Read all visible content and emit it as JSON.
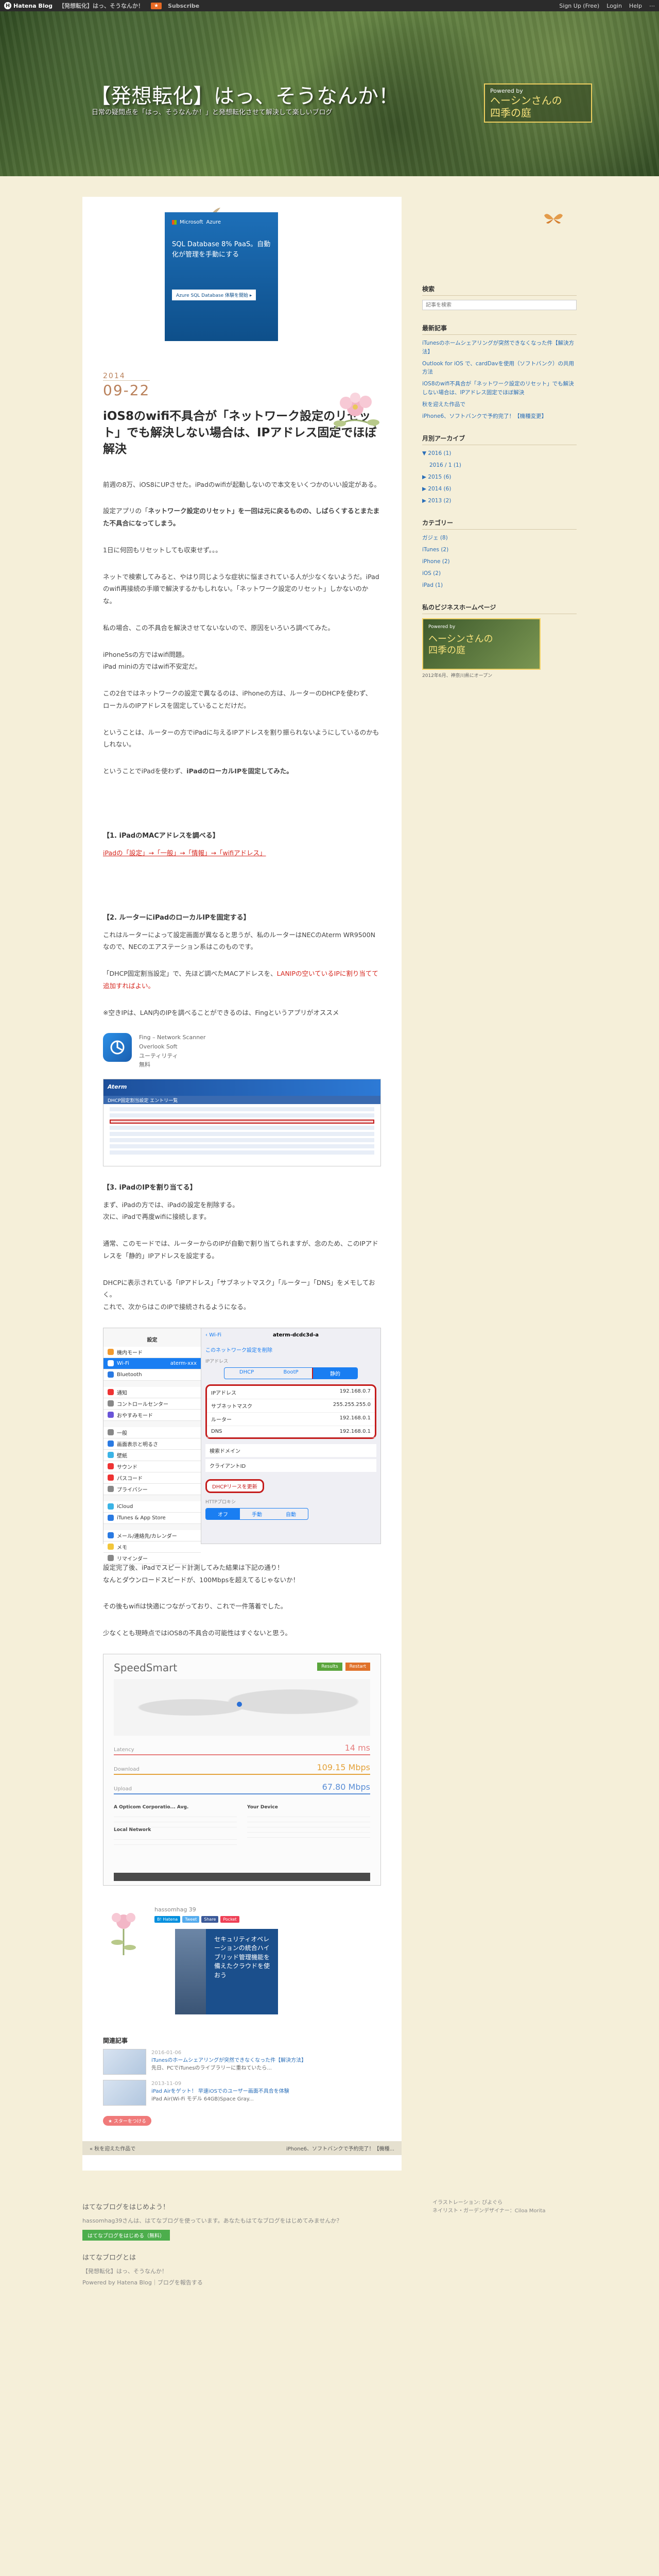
{
  "topbar": {
    "brand": "Hatena Blog",
    "blog_name": "【発想転化】はっ、そうなんか！",
    "star": "★",
    "subscribe": "Subscribe",
    "signup": "Sign Up (Free)",
    "login": "Login",
    "help": "Help",
    "more": "⋯"
  },
  "header": {
    "title": "【発想転化】はっ、そうなんか！",
    "description": "日常の疑問点を「はっ、そうなんか！」と発想転化させて解決して楽しいブログ",
    "badge_by": "Powered by",
    "badge_title": "ヘーシンさんの\n四季の庭"
  },
  "ad_top": {
    "brand": "Microsoft",
    "partner": "Azure",
    "headline": "SQL Database 8% PaaS。自動化が管理を手動にする",
    "button": "Azure SQL Database 体験を開始 ▸"
  },
  "entry": {
    "year": "2014",
    "date": "09-22",
    "title": "iOS8のwifi不具合が「ネットワーク設定のリセット」でも解決しない場合は、IPアドレス固定でほぼ解決",
    "p1": "前週の8万、iOS8にUPさせた。iPadのwifiが起動しないので本文をいくつかのいい設定がある。",
    "p2a": "設定アプリの「",
    "p2b": "ネットワーク設定のリセット",
    "p2c": "」を一回は元に戻るものの、しばらくするとまたまた不具合になってしまう。",
    "p3": "1日に何回もリセットしても収束せず。。。",
    "p4": "ネットで検索してみると、やはり同じような症状に悩まされている人が少なくないようだ。iPadのwifi再接続の手順で解決するかもしれない。「ネットワーク設定のリセット」しかないのかな。",
    "p5": "私の場合、この不具合を解決させてないないので、原因をいろいろ調べてみた。",
    "p6a": "iPhone5sの方ではwifi問題。",
    "p6b": "iPad miniの方ではwifi不安定だ。",
    "p7a": "この2台ではネットワークの設定で異なるのは、iPhoneの方は、ルーターのDHCPを使わず、",
    "p7b": "ローカルのIPアドレスを固定していることだけだ。",
    "p8": "ということは、ルーターの方でiPadに与えるIPアドレスを割り振られないようにしているのかもしれない。",
    "p9a": "ということでiPadを使わず、",
    "p9b": "iPadのローカルIPを固定してみた。",
    "h1": "【1. iPadのMACアドレスを調べる】",
    "h1_path": "iPadの「設定」→「一般」→「情報」→「wifiアドレス」",
    "h2": "【2. ルーターにiPadのローカルIPを固定する】",
    "p10": "これはルーターによって設定画面が異なると思うが、私のルーターはNECのAterm WR9500Nなので、NECのエアステーション系はこのものです。",
    "p11a": "「DHCP固定割当設定」で、先ほど調べたMACアドレスを、",
    "p11b": "LANIPの空いているIPに割り当てて追加すればよい。",
    "p12": "※空きIPは、LAN内のIPを調べることができるのは、Fingというアプリがオススメ",
    "h3": "【3. iPadのIPを割り当てる】",
    "p13a": "まず、iPadの方では、iPadの設定を削除する。",
    "p13b": "次に、iPadで再度wifiに接続します。",
    "p14": "通常、このモードでは、ルーターからのIPが自動で割り当てられますが、念のため、このIPアドレスを「静的」IPアドレスを設定する。",
    "p15a": "DHCPに表示されている「IPアドレス」「サブネットマスク」「ルーター」「DNS」をメモしておく。",
    "p15b": "これで、次からはこのIPで接続されるようになる。",
    "p16a": "設定完了後、iPadでスピード計測してみた結果は下記の通り！",
    "p16b": "なんとダウンロードスピードが、100Mbpsを超えてるじゃないか！",
    "p17": "その後もwifiは快適につながっており、これで一件落着でした。",
    "p18": "少なくとも現時点ではiOS8の不具合の可能性はすぐないと思う。"
  },
  "app": {
    "name": "Fing – Network Scanner",
    "maker": "Overlook Soft",
    "category": "ユーティリティ",
    "price": "無料"
  },
  "router_ss": {
    "brand": "Aterm",
    "title": "DHCP固定割当設定 エントリ一覧"
  },
  "ipad_ss": {
    "left_header": "設定",
    "items": [
      "機内モード",
      "Wi-Fi",
      "Bluetooth",
      "通知",
      "コントロールセンター",
      "おやすみモード",
      "一般",
      "画面表示と明るさ",
      "壁紙",
      "サウンド",
      "パスコード",
      "プライバシー",
      "iCloud",
      "iTunes & App Store",
      "メール/連絡先/カレンダー",
      "メモ",
      "リマインダー"
    ],
    "wifi_value": "aterm-xxx",
    "nav_back": "Wi-Fi",
    "nav_title": "aterm-dcdc3d-a",
    "forget": "このネットワーク設定を削除",
    "ip_label": "IPアドレス",
    "segments": [
      "DHCP",
      "BootP",
      "静的"
    ],
    "ip_rows": [
      {
        "k": "IPアドレス",
        "v": "192.168.0.7"
      },
      {
        "k": "サブネットマスク",
        "v": "255.255.255.0"
      },
      {
        "k": "ルーター",
        "v": "192.168.0.1"
      },
      {
        "k": "DNS",
        "v": "192.168.0.1"
      }
    ],
    "search_domain": "検索ドメイン",
    "client_id": "クライアントID",
    "dhcp_button": "DHCPリースを更新",
    "http_proxy": "HTTPプロキシ",
    "proxy_segments": [
      "オフ",
      "手動",
      "自動"
    ]
  },
  "speed_ss": {
    "brand": "SpeedSmart",
    "btn_a": "Results",
    "btn_b": "Restart",
    "latency_label": "Latency",
    "latency_val": "14 ms",
    "download_label": "Download",
    "download_val": "109.15 Mbps",
    "upload_label": "Upload",
    "upload_val": "67.80 Mbps",
    "col1": "A Opticom Corporatio... Avg.",
    "col2": "Your Device",
    "col3": "Local Network"
  },
  "author": {
    "name": "hassomhag 39",
    "share_a": "B! Hatena",
    "share_b": "Tweet",
    "share_c": "Share",
    "share_d": "Pocket"
  },
  "ad_side": {
    "text": "セキュリティオペレーションの統合ハイブリッド管理機能を備えたクラウドを使おう"
  },
  "related": {
    "heading": "関連記事",
    "items": [
      {
        "date": "2016-01-06",
        "title": "iTunesのホームシェアリングが突然できなくなった件【解決方法】",
        "desc": "先日、PCでiTunesのライブラリーに重ねていたら..."
      },
      {
        "date": "2013-11-09",
        "title": "iPad Airをゲット！ 早速iOSでのユーザー画面不具合を体験",
        "desc": "iPad Air(Wi-Fi モデル 64GB)Space Gray..."
      }
    ]
  },
  "star_btn": "★ スターをつける",
  "pager": {
    "prev": "« 秋を迎えた作品で",
    "next": "iPhone6、ソフトバンクで予約完了！【機種..."
  },
  "sidebar": {
    "search_h": "検索",
    "search_ph": "記事を検索",
    "recent_h": "最新記事",
    "recent": [
      "iTunesのホームシェアリングが突然できなくなった件【解決方法】",
      "Outlook for iOS で、cardDavを使用（ソフトバンク）の共用方法",
      "iOS8のwifi不具合が「ネットワーク設定のリセット」でも解決しない場合は、IPアドレス固定でほぼ解決",
      "秋を迎えた作品で",
      "iPhone6、ソフトバンクで予約完了！【機種変更】"
    ],
    "archive_h": "月別アーカイブ",
    "archive": [
      "▼ 2016 (1)",
      "2016 / 1 (1)",
      "▶ 2015 (6)",
      "▶ 2014 (6)",
      "▶ 2013 (2)"
    ],
    "category_h": "カテゴリー",
    "categories": [
      "ガジェ (8)",
      "iTunes (2)",
      "iPhone (2)",
      "iOS (2)",
      "iPad (1)"
    ],
    "biz_h": "私のビジネスホームページ",
    "banner_by": "Powered by",
    "banner_title": "ヘーシンさんの\n四季の庭",
    "banner_sub": "2012年6月、神奈川県にオープン"
  },
  "footer": {
    "q": "はてなブログをはじめよう！",
    "desc": "hassomhag39さんは、はてなブログを使っています。あなたもはてなブログをはじめてみませんか？",
    "btn": "はてなブログをはじめる（無料）",
    "about": "はてなブログとは",
    "ln1": "【発想転化】はっ、そうなんか！",
    "ln2": "Powered by Hatena Blog｜ブログを報告する",
    "right1": "イラストレーション: ぴよぐら",
    "right2": "ネイリスト・ガーデンデザイナー：Ciloa Morita"
  }
}
